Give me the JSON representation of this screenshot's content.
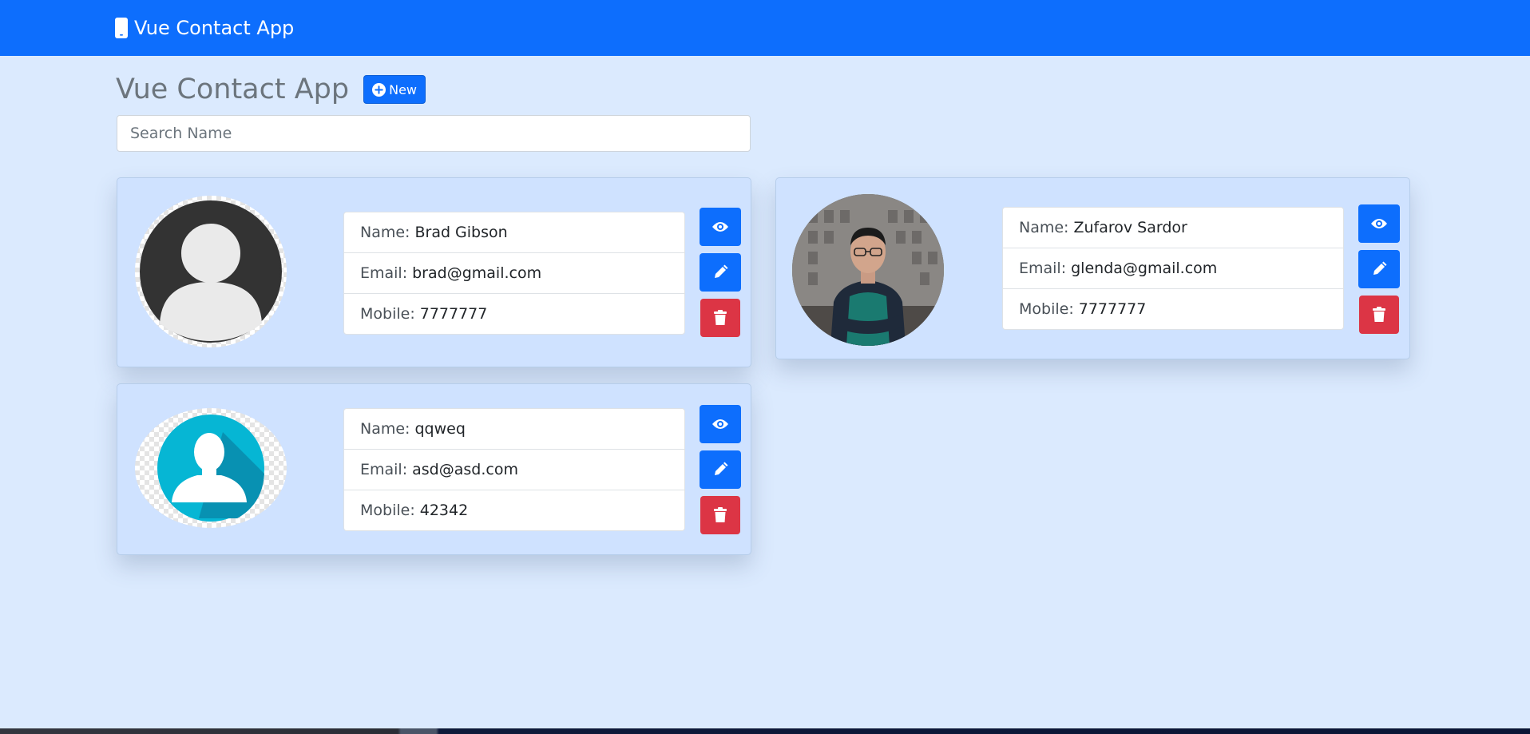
{
  "navbar": {
    "brand_title": "Vue Contact App",
    "brand_icon": "mobile-phone-icon",
    "background": "#0d6efd"
  },
  "header": {
    "title": "Vue Contact App",
    "new_button_label": "New",
    "new_button_icon": "plus-circle-icon"
  },
  "search": {
    "placeholder": "Search Name",
    "value": ""
  },
  "labels": {
    "name": "Name:",
    "email": "Email:",
    "mobile": "Mobile:"
  },
  "contacts": [
    {
      "name": "Brad Gibson",
      "email": "brad@gmail.com",
      "mobile": "7777777",
      "avatar": "default-user-avatar"
    },
    {
      "name": "Zufarov Sardor",
      "email": "glenda@gmail.com",
      "mobile": "7777777",
      "avatar": "user-photo"
    },
    {
      "name": "qqweq",
      "email": "asd@asd.com",
      "mobile": "42342",
      "avatar": "teal-user-avatar"
    }
  ],
  "action_icons": {
    "view": "eye-icon",
    "edit": "pencil-icon",
    "delete": "trash-icon"
  },
  "colors": {
    "primary": "#0d6efd",
    "danger": "#dc3545",
    "page_background": "#dbeafe",
    "card_background": "#cfe2ff"
  }
}
